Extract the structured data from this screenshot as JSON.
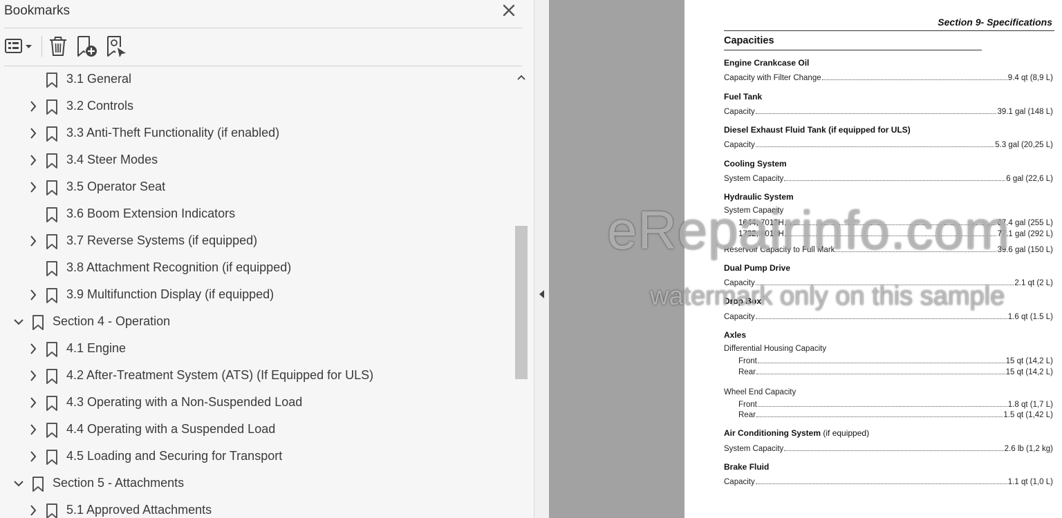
{
  "panel": {
    "title": "Bookmarks",
    "toolbar": {
      "options_icon": "bookmark-options-icon",
      "delete_icon": "trash-icon",
      "new_bookmark_icon": "new-bookmark-icon",
      "expand_current_icon": "expand-current-bookmark-icon"
    },
    "items": [
      {
        "label": "3.1 General",
        "level": 1,
        "expander": "none"
      },
      {
        "label": "3.2 Controls",
        "level": 1,
        "expander": "collapsed"
      },
      {
        "label": "3.3 Anti-Theft Functionality (if enabled)",
        "level": 1,
        "expander": "collapsed"
      },
      {
        "label": "3.4 Steer Modes",
        "level": 1,
        "expander": "collapsed"
      },
      {
        "label": "3.5 Operator Seat",
        "level": 1,
        "expander": "collapsed"
      },
      {
        "label": "3.6 Boom Extension Indicators",
        "level": 1,
        "expander": "none"
      },
      {
        "label": "3.7 Reverse Systems (if equipped)",
        "level": 1,
        "expander": "collapsed"
      },
      {
        "label": "3.8 Attachment Recognition (if equipped)",
        "level": 1,
        "expander": "none"
      },
      {
        "label": "3.9 Multifunction Display (if equipped)",
        "level": 1,
        "expander": "collapsed"
      },
      {
        "label": "Section 4 - Operation",
        "level": 0,
        "expander": "expanded"
      },
      {
        "label": "4.1 Engine",
        "level": 1,
        "expander": "collapsed"
      },
      {
        "label": "4.2 After-Treatment System (ATS) (If Equipped for ULS)",
        "level": 1,
        "expander": "collapsed"
      },
      {
        "label": "4.3 Operating with a Non-Suspended Load",
        "level": 1,
        "expander": "collapsed"
      },
      {
        "label": "4.4 Operating with a Suspended Load",
        "level": 1,
        "expander": "collapsed"
      },
      {
        "label": "4.5 Loading and Securing for Transport",
        "level": 1,
        "expander": "collapsed"
      },
      {
        "label": "Section 5 - Attachments",
        "level": 0,
        "expander": "expanded"
      },
      {
        "label": "5.1 Approved Attachments",
        "level": 1,
        "expander": "collapsed"
      }
    ],
    "scroll_position_fraction": 0.35
  },
  "document": {
    "section_header": "Section 9- Specifications",
    "title": "Capacities",
    "groups": [
      {
        "title": "Engine Crankcase Oil",
        "rows": [
          {
            "label": "Capacity with Filter Change",
            "value": "9.4 qt (8,9 L)"
          }
        ]
      },
      {
        "title": "Fuel Tank",
        "rows": [
          {
            "label": "Capacity",
            "value": "39.1 gal (148 L)"
          }
        ]
      },
      {
        "title": "Diesel Exhaust Fluid Tank (if equipped for ULS)",
        "rows": [
          {
            "label": "Capacity",
            "value": "5.3 gal (20,25 L)"
          }
        ]
      },
      {
        "title": "Cooling System",
        "rows": [
          {
            "label": "System Capacity",
            "value": "6 gal (22,6 L)"
          }
        ]
      },
      {
        "title": "Hydraulic System",
        "subheading": "System Capacity",
        "rows": [
          {
            "label": "1644, 7013H",
            "value": "67.4 gal (255 L)",
            "indent": true
          },
          {
            "label": "1732, 8010H",
            "value": "77.1 gal (292 L)",
            "indent": true
          },
          {
            "label": "Reservoir Capacity to Full Mark",
            "value": "39.6 gal (150 L)"
          }
        ]
      },
      {
        "title": "Dual Pump Drive",
        "rows": [
          {
            "label": "Capacity",
            "value": "2.1 qt (2 L)"
          }
        ]
      },
      {
        "title": "Drop Box",
        "rows": [
          {
            "label": "Capacity",
            "value": "1.6 qt (1.5 L)"
          }
        ]
      },
      {
        "title": "Axles",
        "subheading": "Differential Housing Capacity",
        "rows": [
          {
            "label": "Front",
            "value": "15 qt (14,2 L)",
            "indent": true
          },
          {
            "label": "Rear",
            "value": "15 qt (14,2 L)",
            "indent": true
          }
        ],
        "subheading2": "Wheel End Capacity",
        "rows2": [
          {
            "label": "Front",
            "value": "1.8 qt (1,7 L)",
            "indent": true
          },
          {
            "label": "Rear",
            "value": "1.5 qt (1,42 L)",
            "indent": true
          }
        ]
      },
      {
        "title": "Air Conditioning System",
        "title_suffix": "(if equipped)",
        "rows": [
          {
            "label": "System Capacity",
            "value": "2.6 lb (1,2 kg)"
          }
        ]
      },
      {
        "title": "Brake Fluid",
        "rows": [
          {
            "label": "Capacity",
            "value": "1.1 qt (1,0 L)"
          }
        ]
      }
    ]
  },
  "watermark": {
    "line1": "eRepairinfo.com",
    "line2": "watermark only on this sample"
  }
}
